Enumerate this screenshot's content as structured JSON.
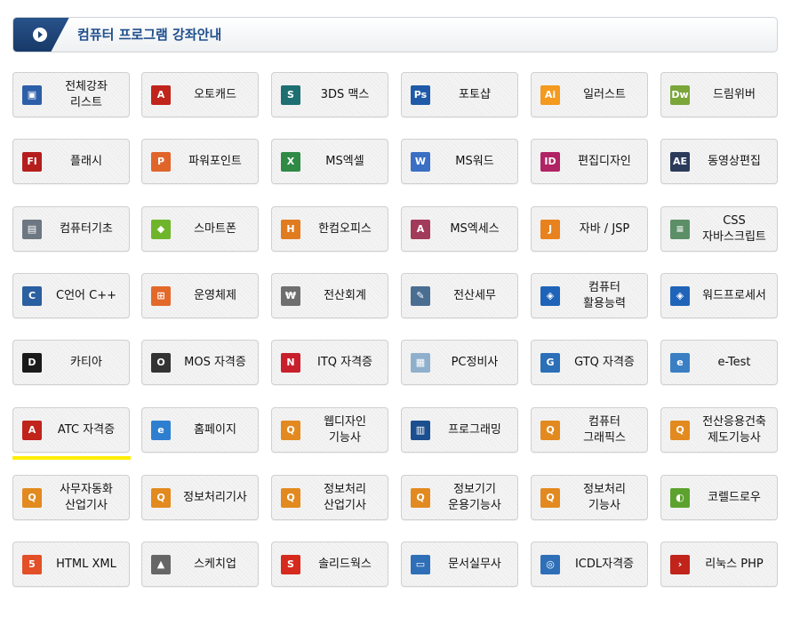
{
  "header": {
    "title": "컴퓨터 프로그램 강좌안내"
  },
  "courses": [
    {
      "label": "전체강좌\n리스트",
      "icon": "computer-icon",
      "color": "#2d5fa8"
    },
    {
      "label": "오토캐드",
      "icon": "autocad-icon",
      "color": "#c0241b"
    },
    {
      "label": "3DS 맥스",
      "icon": "3ds-max-icon",
      "color": "#1d6f72"
    },
    {
      "label": "포토샵",
      "icon": "photoshop-icon",
      "color": "#1f5aa8"
    },
    {
      "label": "일러스트",
      "icon": "illustrator-icon",
      "color": "#f39a1f"
    },
    {
      "label": "드림위버",
      "icon": "dreamweaver-icon",
      "color": "#7aa63a"
    },
    {
      "label": "플래시",
      "icon": "flash-icon",
      "color": "#b51d1d"
    },
    {
      "label": "파워포인트",
      "icon": "powerpoint-icon",
      "color": "#e0652b"
    },
    {
      "label": "MS엑셀",
      "icon": "excel-icon",
      "color": "#2e8a45"
    },
    {
      "label": "MS워드",
      "icon": "word-icon",
      "color": "#3a6fc4"
    },
    {
      "label": "편집디자인",
      "icon": "indesign-icon",
      "color": "#b02364"
    },
    {
      "label": "동영상편집",
      "icon": "after-effects-icon",
      "color": "#2b3a5a"
    },
    {
      "label": "컴퓨터기초",
      "icon": "computer-basics-icon",
      "color": "#6d7782"
    },
    {
      "label": "스마트폰",
      "icon": "android-icon",
      "color": "#6fb52c"
    },
    {
      "label": "한컴오피스",
      "icon": "hancom-office-icon",
      "color": "#e07b1f"
    },
    {
      "label": "MS엑세스",
      "icon": "access-icon",
      "color": "#a23a5a"
    },
    {
      "label": "자바 / JSP",
      "icon": "java-icon",
      "color": "#e8821e"
    },
    {
      "label": "CSS\n자바스크립트",
      "icon": "css-javascript-icon",
      "color": "#5c8f68"
    },
    {
      "label": "C언어 C++",
      "icon": "c-language-icon",
      "color": "#2a5fa0"
    },
    {
      "label": "운영체제",
      "icon": "windows-icon",
      "color": "#e3692a"
    },
    {
      "label": "전산회계",
      "icon": "accounting-icon",
      "color": "#6e6e6e"
    },
    {
      "label": "전산세무",
      "icon": "tax-accounting-icon",
      "color": "#4a6e92"
    },
    {
      "label": "컴퓨터\n활용능력",
      "icon": "computer-skills-icon",
      "color": "#1f64b8"
    },
    {
      "label": "워드프로세서",
      "icon": "word-processor-icon",
      "color": "#1f64b8"
    },
    {
      "label": "카티아",
      "icon": "catia-icon",
      "color": "#1a1a1a"
    },
    {
      "label": "MOS 자격증",
      "icon": "mos-icon",
      "color": "#333333"
    },
    {
      "label": "ITQ 자격증",
      "icon": "itq-icon",
      "color": "#c81f2d"
    },
    {
      "label": "PC정비사",
      "icon": "pc-maintenance-icon",
      "color": "#8fb0cc"
    },
    {
      "label": "GTQ 자격증",
      "icon": "gtq-icon",
      "color": "#2a6fb8"
    },
    {
      "label": "e-Test",
      "icon": "e-test-icon",
      "color": "#3a7fc4"
    },
    {
      "label": "ATC 자격증",
      "icon": "atc-icon",
      "color": "#c0241b"
    },
    {
      "label": "홈페이지",
      "icon": "internet-explorer-icon",
      "color": "#2f7fd0"
    },
    {
      "label": "웹디자인\n기능사",
      "icon": "q-net-icon",
      "color": "#e28a1f"
    },
    {
      "label": "프로그래밍",
      "icon": "programming-icon",
      "color": "#1b4f8f"
    },
    {
      "label": "컴퓨터\n그래픽스",
      "icon": "q-net-icon",
      "color": "#e28a1f"
    },
    {
      "label": "전산응용건축\n제도기능사",
      "icon": "q-net-icon",
      "color": "#e28a1f"
    },
    {
      "label": "사무자동화\n산업기사",
      "icon": "q-net-icon",
      "color": "#e28a1f"
    },
    {
      "label": "정보처리기사",
      "icon": "q-net-icon",
      "color": "#e28a1f"
    },
    {
      "label": "정보처리\n산업기사",
      "icon": "q-net-icon",
      "color": "#e28a1f"
    },
    {
      "label": "정보기기\n운용기능사",
      "icon": "q-net-icon",
      "color": "#e28a1f"
    },
    {
      "label": "정보처리\n기능사",
      "icon": "q-net-icon",
      "color": "#e28a1f"
    },
    {
      "label": "코렐드로우",
      "icon": "coreldraw-icon",
      "color": "#5da22f"
    },
    {
      "label": "HTML XML",
      "icon": "html5-icon",
      "color": "#e34f26"
    },
    {
      "label": "스케치업",
      "icon": "sketchup-icon",
      "color": "#666666"
    },
    {
      "label": "솔리드웍스",
      "icon": "solidworks-icon",
      "color": "#d62a1f"
    },
    {
      "label": "문서실무사",
      "icon": "document-icon",
      "color": "#2f6fb8"
    },
    {
      "label": "ICDL자격증",
      "icon": "icdl-icon",
      "color": "#2f6fb8"
    },
    {
      "label": "리눅스 PHP",
      "icon": "linux-php-icon",
      "color": "#c0241b"
    }
  ],
  "icon_glyphs": {
    "computer-icon": "▣",
    "autocad-icon": "A",
    "3ds-max-icon": "S",
    "photoshop-icon": "Ps",
    "illustrator-icon": "Ai",
    "dreamweaver-icon": "Dw",
    "flash-icon": "Fl",
    "powerpoint-icon": "P",
    "excel-icon": "X",
    "word-icon": "W",
    "indesign-icon": "ID",
    "after-effects-icon": "AE",
    "computer-basics-icon": "▤",
    "android-icon": "◆",
    "hancom-office-icon": "H",
    "access-icon": "A",
    "java-icon": "J",
    "css-javascript-icon": "≡",
    "c-language-icon": "C",
    "windows-icon": "⊞",
    "accounting-icon": "₩",
    "tax-accounting-icon": "✎",
    "computer-skills-icon": "◈",
    "word-processor-icon": "◈",
    "catia-icon": "D",
    "mos-icon": "O",
    "itq-icon": "N",
    "pc-maintenance-icon": "▦",
    "gtq-icon": "G",
    "e-test-icon": "e",
    "atc-icon": "A",
    "internet-explorer-icon": "e",
    "q-net-icon": "Q",
    "programming-icon": "▥",
    "coreldraw-icon": "◐",
    "html5-icon": "5",
    "sketchup-icon": "▲",
    "solidworks-icon": "S",
    "document-icon": "▭",
    "icdl-icon": "◎",
    "linux-php-icon": "›"
  }
}
